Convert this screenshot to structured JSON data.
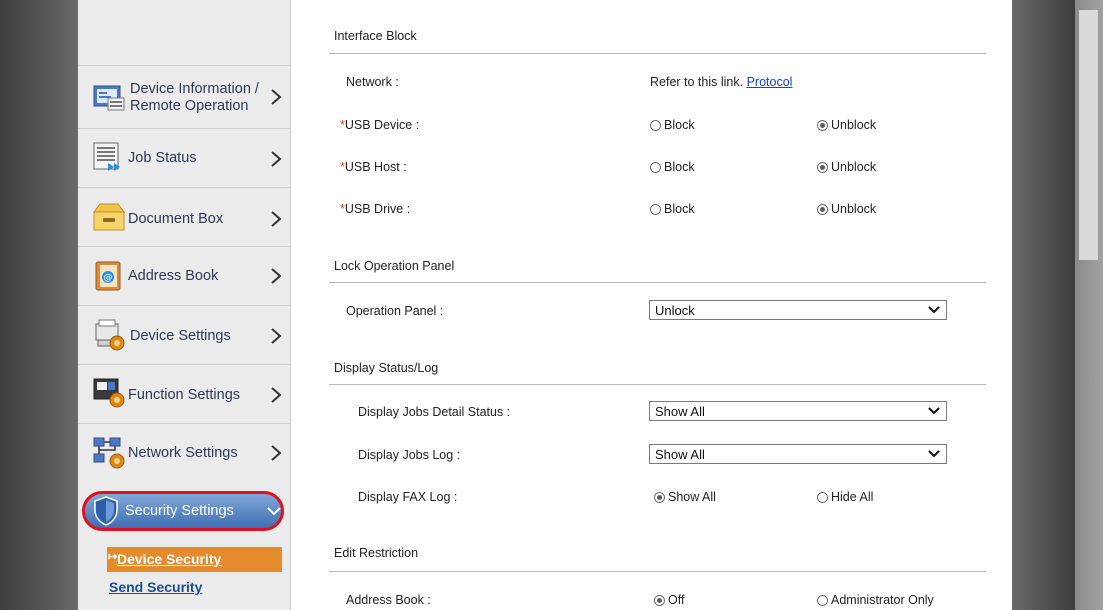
{
  "sidebar": {
    "items": [
      {
        "label_line1": "Device Information /",
        "label_line2": "Remote Operation",
        "icon": "device-info-icon"
      },
      {
        "label": "Job Status",
        "icon": "job-status-icon"
      },
      {
        "label": "Document Box",
        "icon": "document-box-icon"
      },
      {
        "label": "Address Book",
        "icon": "address-book-icon"
      },
      {
        "label": "Device Settings",
        "icon": "device-settings-icon"
      },
      {
        "label": "Function Settings",
        "icon": "function-settings-icon"
      },
      {
        "label": "Network Settings",
        "icon": "network-settings-icon"
      },
      {
        "label": "Security Settings",
        "icon": "shield-icon"
      }
    ],
    "sub_items": [
      {
        "label": "Device Security",
        "active": true
      },
      {
        "label": "Send Security",
        "active": false
      }
    ]
  },
  "interface_block": {
    "title": "Interface Block",
    "network_label": "Network :",
    "network_text": "Refer to this link.",
    "network_link": "Protocol",
    "usb_device_label": "USB Device :",
    "usb_host_label": "USB Host :",
    "usb_drive_label": "USB Drive :",
    "required_mark": "*",
    "block_label": "Block",
    "unblock_label": "Unblock"
  },
  "lock_panel": {
    "title": "Lock Operation Panel",
    "operation_panel_label": "Operation Panel :",
    "operation_panel_value": "Unlock"
  },
  "display_status": {
    "title": "Display Status/Log",
    "jobs_detail_label": "Display Jobs Detail Status :",
    "jobs_detail_value": "Show All",
    "jobs_log_label": "Display Jobs Log :",
    "jobs_log_value": "Show All",
    "fax_log_label": "Display FAX Log :",
    "fax_show_all": "Show All",
    "fax_hide_all": "Hide All"
  },
  "edit_restriction": {
    "title": "Edit Restriction",
    "address_book_label": "Address Book :",
    "off_label": "Off",
    "admin_only_label": "Administrator Only"
  },
  "colors": {
    "accent_orange": "#e68a2e",
    "highlight_red": "#e0101e",
    "link_blue": "#1a3fd8",
    "security_blue": "#3d6fb3"
  }
}
